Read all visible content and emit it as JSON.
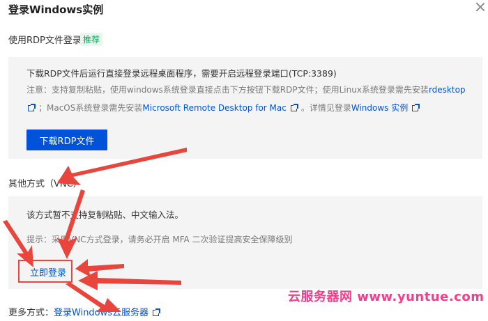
{
  "dialog": {
    "title": "登录Windows实例"
  },
  "rdp": {
    "label": "使用RDP文件登录",
    "badge": "推荐",
    "instruction": "下载RDP文件后运行直接登录远程桌面程序，需要开启远程登录端口(TCP:3389)",
    "note_prefix": "注意：支持复制粘贴，使用windows系统登录直接点击下方按钮下载RDP文件；使用Linux系统登录需先安装",
    "note_link1": "rdesktop",
    "note_mid": "；MacOS系统登录需先安装",
    "note_link2": "Microsoft Remote Desktop for Mac",
    "note_suffix": "。详情见登录",
    "note_link3": "Windows 实例",
    "download_button": "下载RDP文件"
  },
  "vnc": {
    "label": "其他方式（VNC）",
    "warning": "该方式暂不支持复制粘贴、中文输入法。",
    "tip": "提示：采用VNC方式登录，请务必开启 MFA 二次验证提高安全保障级别",
    "login_link": "立即登录"
  },
  "more": {
    "label": "更多方式：",
    "link": "登录Windows云服务器"
  },
  "watermark": {
    "text": "云服务器网 www.yuntue.com"
  },
  "colors": {
    "accent": "#0052d9",
    "badge_green": "#0aa55a",
    "annotation_red": "#e8453c",
    "watermark_pink": "#f53d8b"
  },
  "icons": {
    "close": "close-icon",
    "external": "external-link-icon"
  }
}
